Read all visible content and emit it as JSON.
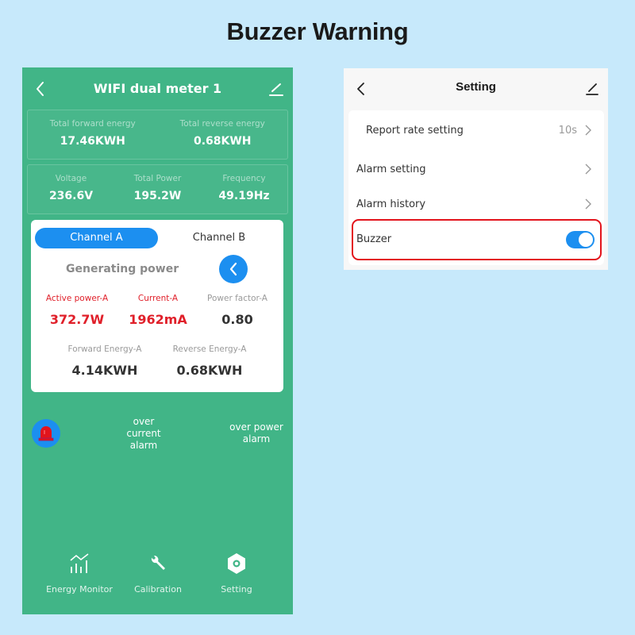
{
  "headline": "Buzzer Warning",
  "meter": {
    "title": "WIFI dual meter 1",
    "totals": [
      {
        "label": "Total  forward energy",
        "value": "17.46KWH"
      },
      {
        "label": "Total reverse energy",
        "value": "0.68KWH"
      }
    ],
    "readings": [
      {
        "label": "Voltage",
        "value": "236.6V"
      },
      {
        "label": "Total Power",
        "value": "195.2W"
      },
      {
        "label": "Frequency",
        "value": "49.19Hz"
      }
    ],
    "channel_tabs": [
      {
        "label": "Channel A",
        "active": true
      },
      {
        "label": "Channel B",
        "active": false
      }
    ],
    "status": "Generating power",
    "metrics": [
      {
        "label": "Active power-A",
        "value": "372.7W",
        "alert": true
      },
      {
        "label": "Current-A",
        "value": "1962mA",
        "alert": true
      },
      {
        "label": "Power factor-A",
        "value": "0.80",
        "alert": false
      },
      {
        "label": "Forward Energy-A",
        "value": "4.14KWH",
        "alert": false
      },
      {
        "label": "Reverse Energy-A",
        "value": "0.68KWH",
        "alert": false
      }
    ],
    "alarms": {
      "icon": "siren-icon",
      "over_current": "over\ncurrent\nalarm",
      "over_current_lines": [
        "over",
        "current",
        "alarm"
      ],
      "over_power_lines": [
        "over power",
        "alarm"
      ]
    },
    "bottom_nav": [
      {
        "label": "Energy Monitor",
        "icon": "chart-icon"
      },
      {
        "label": "Calibration",
        "icon": "wrench-icon"
      },
      {
        "label": "Setting",
        "icon": "hex-nut-icon"
      }
    ]
  },
  "setting": {
    "title": "Setting",
    "rows": [
      {
        "label": "Report rate setting",
        "value": "10s"
      },
      {
        "label": "Alarm setting",
        "value": ""
      },
      {
        "label": "Alarm history",
        "value": ""
      },
      {
        "label": "Buzzer",
        "toggle_on": true
      }
    ]
  },
  "colors": {
    "background": "#c7e9fb",
    "meter_green": "#41b587",
    "accent_blue": "#1c8ff0",
    "alert_red": "#e0202a",
    "highlight_red": "#e3141c"
  }
}
